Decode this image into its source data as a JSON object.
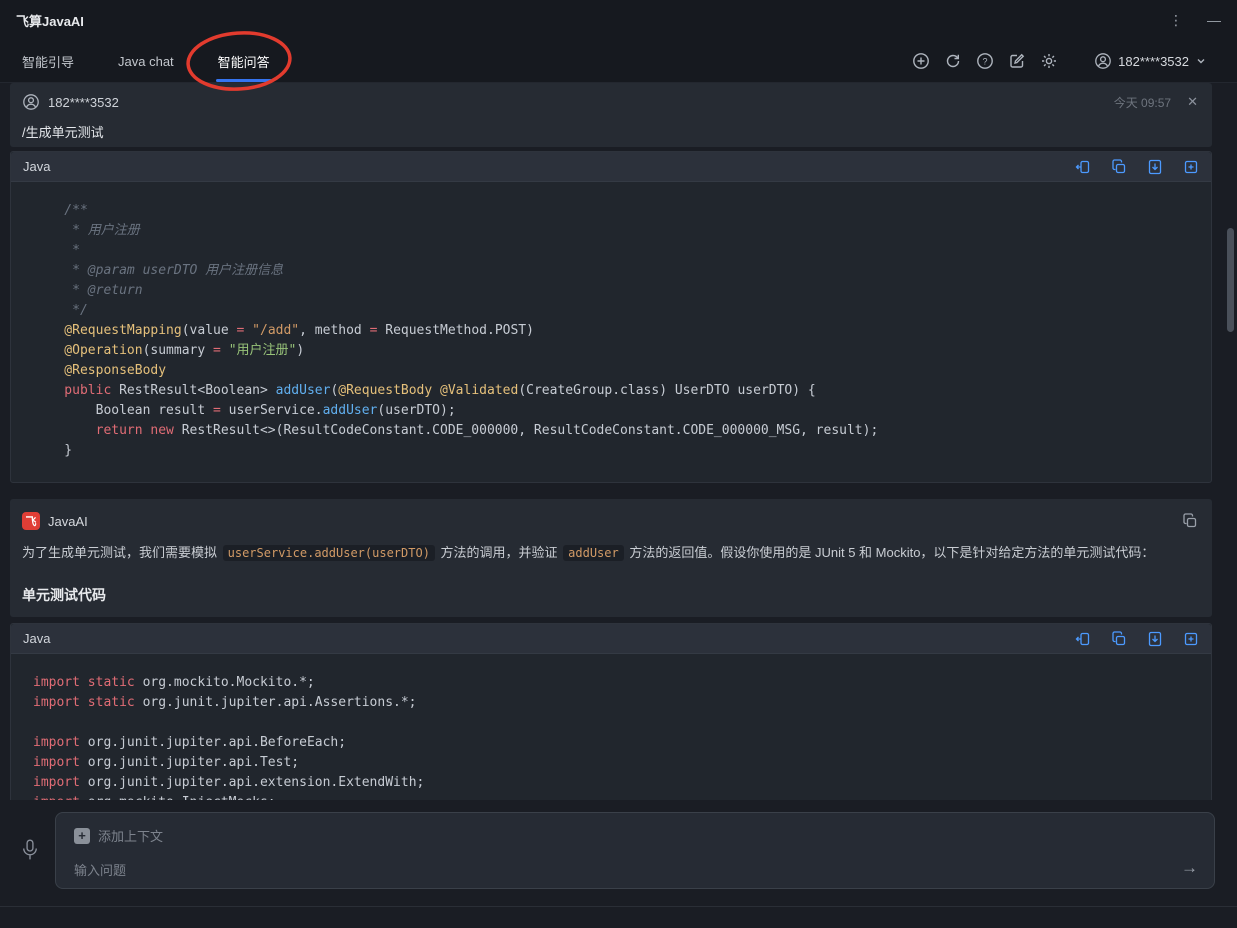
{
  "app": {
    "title": "飞算JavaAI"
  },
  "titlebar": {
    "more_glyph": "⋮",
    "minimize_glyph": "—"
  },
  "tabs": [
    {
      "label": "智能引导",
      "active": false
    },
    {
      "label": "Java chat",
      "active": false
    },
    {
      "label": "智能问答",
      "active": true
    }
  ],
  "toolbar": {
    "account": "182****3532"
  },
  "annotation": {
    "shape": "red-ellipse",
    "target": "智能问答",
    "color": "#e23b2e"
  },
  "user_message": {
    "name": "182****3532",
    "time": "今天 09:57",
    "close_glyph": "✕",
    "text": "/生成单元测试"
  },
  "code_block_1": {
    "language": "Java",
    "lines": [
      [
        [
          "cm",
          "    /**"
        ]
      ],
      [
        [
          "cm",
          "     * 用户注册"
        ]
      ],
      [
        [
          "cm",
          "     *"
        ]
      ],
      [
        [
          "cm",
          "     * @param userDTO 用户注册信息"
        ]
      ],
      [
        [
          "cm",
          "     * @return"
        ]
      ],
      [
        [
          "cm",
          "     */"
        ]
      ],
      [
        [
          "an",
          "    @RequestMapping"
        ],
        [
          "pl",
          "(value "
        ],
        [
          "op",
          "="
        ],
        [
          "pl",
          " "
        ],
        [
          "s2",
          "\"/add\""
        ],
        [
          "pl",
          ", method "
        ],
        [
          "op",
          "="
        ],
        [
          "pl",
          " RequestMethod.POST)"
        ]
      ],
      [
        [
          "an",
          "    @Operation"
        ],
        [
          "pl",
          "(summary "
        ],
        [
          "op",
          "="
        ],
        [
          "pl",
          " "
        ],
        [
          "st",
          "\"用户注册\""
        ],
        [
          "pl",
          ")"
        ]
      ],
      [
        [
          "an",
          "    @ResponseBody"
        ]
      ],
      [
        [
          "kw",
          "    public"
        ],
        [
          "pl",
          " RestResult<Boolean> "
        ],
        [
          "fn",
          "addUser"
        ],
        [
          "pl",
          "("
        ],
        [
          "an",
          "@RequestBody"
        ],
        [
          "pl",
          " "
        ],
        [
          "an",
          "@Validated"
        ],
        [
          "pl",
          "(CreateGroup.class) UserDTO userDTO) {"
        ]
      ],
      [
        [
          "pl",
          "        Boolean result "
        ],
        [
          "op",
          "="
        ],
        [
          "pl",
          " userService."
        ],
        [
          "fn",
          "addUser"
        ],
        [
          "pl",
          "(userDTO);"
        ]
      ],
      [
        [
          "kw",
          "        return"
        ],
        [
          "pl",
          " "
        ],
        [
          "kw",
          "new"
        ],
        [
          "pl",
          " RestResult<>(ResultCodeConstant.CODE_000000, ResultCodeConstant.CODE_000000_MSG, result);"
        ]
      ],
      [
        [
          "pl",
          "    }"
        ]
      ]
    ]
  },
  "ai_message": {
    "name": "JavaAI",
    "paragraph": [
      {
        "text": "为了生成单元测试，我们需要模拟 "
      },
      {
        "text": "userService.addUser(userDTO)",
        "code": true
      },
      {
        "text": " 方法的调用，并验证 "
      },
      {
        "text": "addUser",
        "code": true
      },
      {
        "text": " 方法的返回值。假设你使用的是 JUnit 5 和 Mockito，以下是针对给定方法的单元测试代码："
      }
    ],
    "section_title": "单元测试代码"
  },
  "code_block_2": {
    "language": "Java",
    "lines": [
      [
        [
          "kw",
          "import static"
        ],
        [
          "pl",
          " org.mockito.Mockito.*;"
        ]
      ],
      [
        [
          "kw",
          "import static"
        ],
        [
          "pl",
          " org.junit.jupiter.api.Assertions.*;"
        ]
      ],
      [],
      [
        [
          "kw",
          "import"
        ],
        [
          "pl",
          " org.junit.jupiter.api.BeforeEach;"
        ]
      ],
      [
        [
          "kw",
          "import"
        ],
        [
          "pl",
          " org.junit.jupiter.api.Test;"
        ]
      ],
      [
        [
          "kw",
          "import"
        ],
        [
          "pl",
          " org.junit.jupiter.api.extension.ExtendWith;"
        ]
      ],
      [
        [
          "kw",
          "import"
        ],
        [
          "pl",
          " org.mockito.InjectMocks;"
        ]
      ]
    ]
  },
  "composer": {
    "add_glyph": "+",
    "add_context_label": "添加上下文",
    "placeholder": "输入问题",
    "send_glyph": "→"
  },
  "colors": {
    "accent_blue": "#3574f0",
    "icon_blue": "#4c9aff",
    "annotation_red": "#e23b2e",
    "ai_logo_red": "#e03e36"
  }
}
